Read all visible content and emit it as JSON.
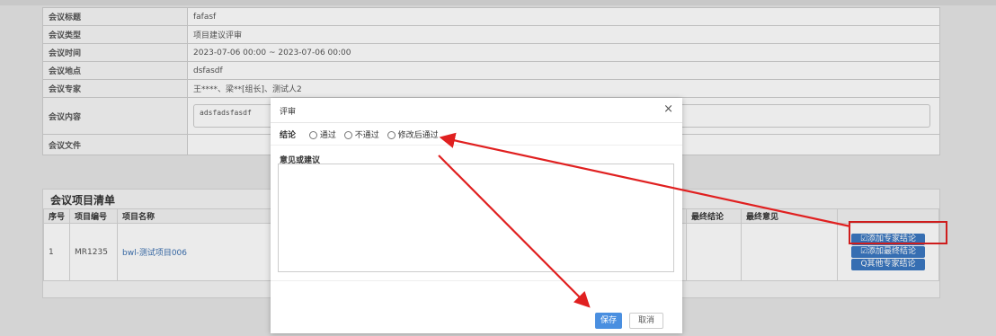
{
  "meeting_info": {
    "rows": [
      {
        "key": "会议标题",
        "value": "fafasf"
      },
      {
        "key": "会议类型",
        "value": "项目建议评审"
      },
      {
        "key": "会议时间",
        "value": "2023-07-06 00:00 ~ 2023-07-06 00:00"
      },
      {
        "key": "会议地点",
        "value": "dsfasdf"
      },
      {
        "key": "会议专家",
        "value": "王****、梁**[组长]、测试人2"
      },
      {
        "key": "会议内容",
        "value": "adsfadsfasdf"
      },
      {
        "key": "会议文件",
        "value": ""
      }
    ]
  },
  "project_list": {
    "title": "会议项目清单",
    "columns": [
      "序号",
      "项目编号",
      "项目名称",
      "最终结论",
      "最终意见"
    ],
    "rows": [
      {
        "index": "1",
        "code": "MR1235",
        "name": "bwl-测试项目006",
        "final_conclusion": "",
        "final_opinion": ""
      }
    ],
    "actions": {
      "add_expert": "☑添加专家结论",
      "add_final": "☑添加最终结论",
      "other_experts": "Q其他专家结论"
    }
  },
  "dialog": {
    "title": "评审",
    "close": "×",
    "conclusion_label": "结论",
    "options": [
      "通过",
      "不通过",
      "修改后通过"
    ],
    "opinion_label": "意见或建议",
    "opinion_value": "",
    "save": "保存",
    "cancel": "取消"
  },
  "colors": {
    "annotation": "#e02020",
    "primary": "#3b78c2",
    "save": "#4a8fe0"
  }
}
